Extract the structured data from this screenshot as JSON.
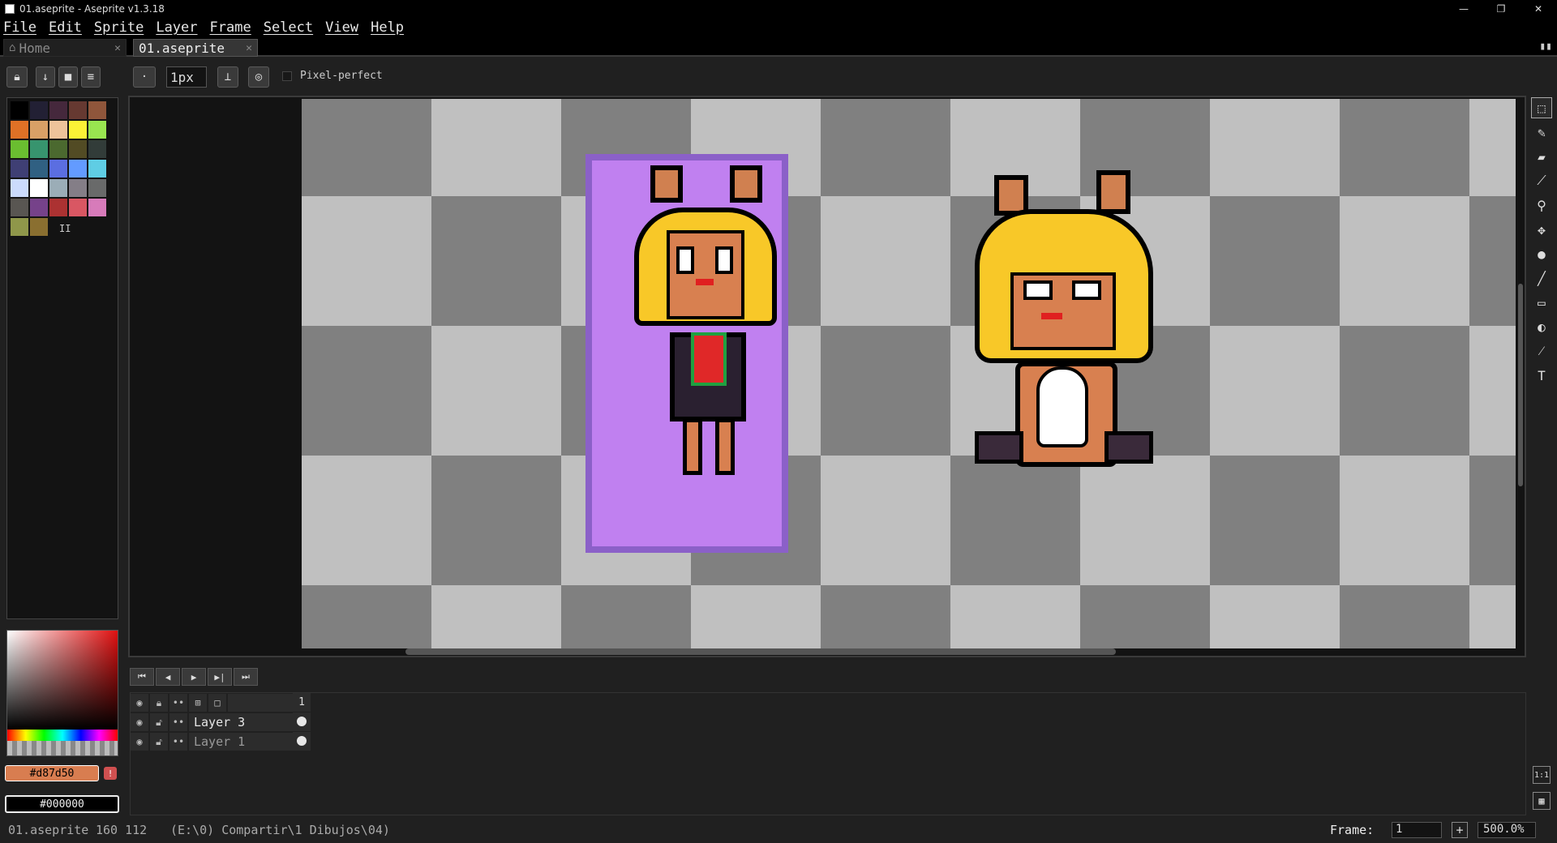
{
  "window": {
    "title": "01.aseprite - Aseprite v1.3.18",
    "minimize": "—",
    "maximize": "❐",
    "close": "✕"
  },
  "menu": [
    "File",
    "Edit",
    "Sprite",
    "Layer",
    "Frame",
    "Select",
    "View",
    "Help"
  ],
  "tabs": [
    {
      "label": "Home",
      "icon": "home-icon",
      "active": false
    },
    {
      "label": "01.aseprite",
      "active": true
    }
  ],
  "context_bar": {
    "brush_size": "1px",
    "pixel_perfect_label": "Pixel-perfect",
    "pixel_perfect_checked": false
  },
  "palette": {
    "colors": [
      "#000000",
      "#222034",
      "#45283c",
      "#663931",
      "#8f563b",
      "#df7126",
      "#d9a066",
      "#eec39a",
      "#fbf236",
      "#99e550",
      "#6abe30",
      "#37946e",
      "#4b692f",
      "#524b24",
      "#323c39",
      "#3f3f74",
      "#306082",
      "#5b6ee1",
      "#639bff",
      "#5fcde4",
      "#cbdbfc",
      "#ffffff",
      "#9badb7",
      "#847e87",
      "#696a6a",
      "#595652",
      "#76428a",
      "#ac3232",
      "#d95763",
      "#d77bba",
      "#8f974a",
      "#8a6f30"
    ],
    "more_label": "II"
  },
  "colors": {
    "foreground": "#d87d50",
    "background": "#000000",
    "accent": "#c080f0"
  },
  "timeline": {
    "frame_header": "1",
    "layers": [
      {
        "name": "Layer 3",
        "visible": true,
        "locked": false
      },
      {
        "name": "Layer 1",
        "visible": true,
        "locked": false
      }
    ]
  },
  "status": {
    "file": "01.aseprite",
    "size": "160 112",
    "path": "(E:\\0) Compartir\\1 Dibujos\\04)",
    "frame_label": "Frame:",
    "frame_value": "1",
    "zoom": "500.0%"
  },
  "tools": [
    "rectangular-marquee-icon",
    "pencil-icon",
    "eraser-icon",
    "eyedropper-icon",
    "zoom-icon",
    "move-icon",
    "paint-bucket-icon",
    "line-icon",
    "rectangle-icon",
    "contour-icon",
    "blur-icon",
    "text-icon"
  ],
  "anim_controls": [
    "⏮",
    "◀",
    "▶",
    "▶|",
    "⏭"
  ]
}
